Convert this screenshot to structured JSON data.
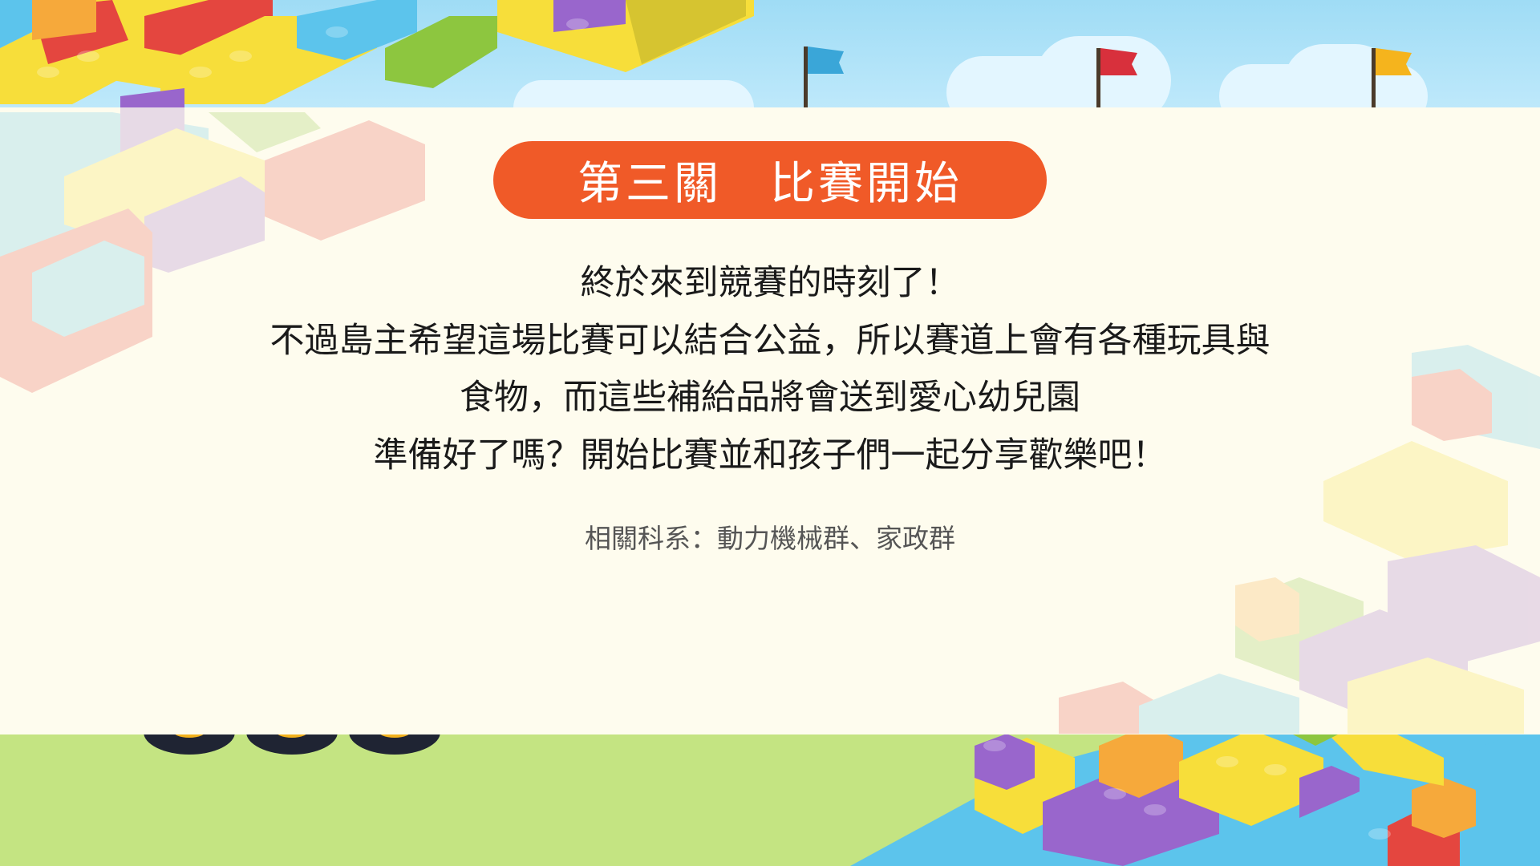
{
  "slide": {
    "title": "第三關　比賽開始",
    "body_lines": [
      "終於來到競賽的時刻了！",
      "不過島主希望這場比賽可以結合公益，所以賽道上會有各種玩具與",
      "食物，而這些補給品將會送到愛心幼兒園",
      "準備好了嗎？開始比賽並和孩子們一起分享歡樂吧！"
    ],
    "related": "相關科系：動力機械群、家政群"
  },
  "flags": [
    {
      "icon": "flag-icon",
      "color": "#3aa6d8"
    },
    {
      "icon": "flag-icon",
      "color": "#d8303c"
    },
    {
      "icon": "flag-icon",
      "color": "#f5b41d"
    }
  ],
  "colors": {
    "title_bg": "#f05a28",
    "panel_bg": "#fefcee",
    "sky": "#b3e4f7",
    "grass": "#c4e482",
    "brick_yellow": "#f7de3a",
    "brick_blue": "#5cc4ec",
    "brick_red": "#e4463f",
    "brick_purple": "#9966cc",
    "brick_orange": "#f6a93b",
    "brick_green": "#8dc63f"
  }
}
